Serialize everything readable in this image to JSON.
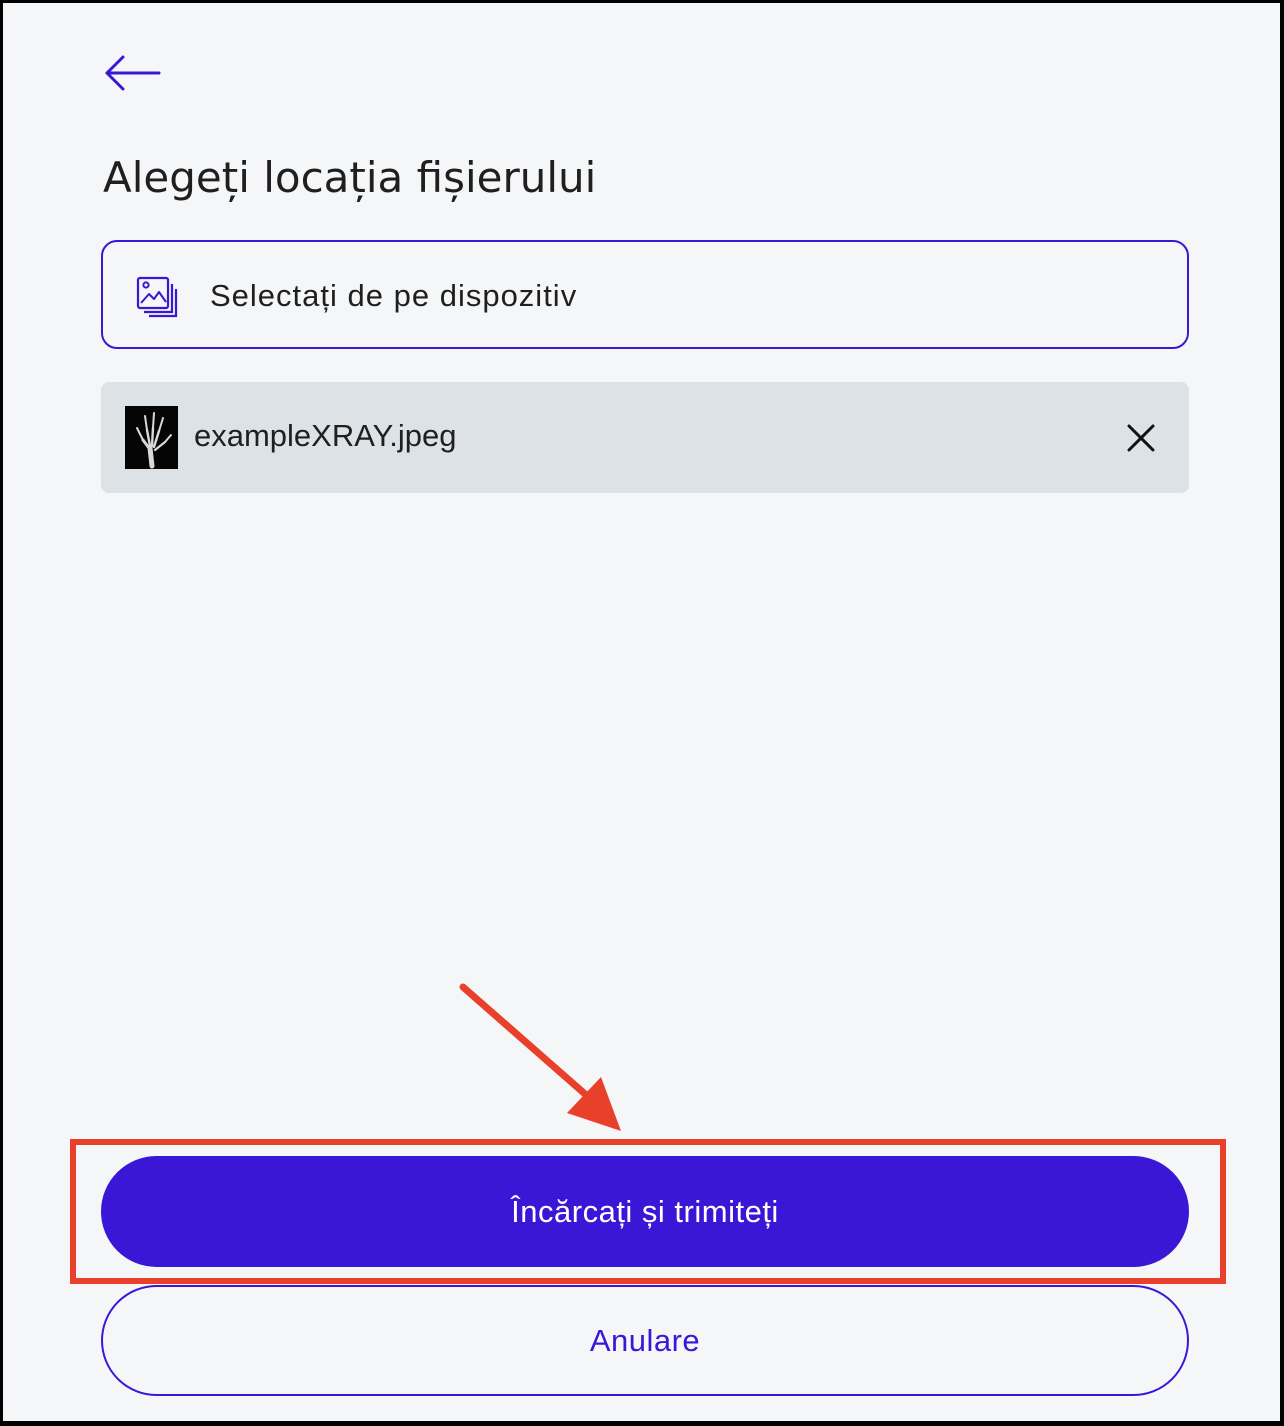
{
  "header": {
    "back_icon": "arrow-left-icon",
    "title": "Alegeți locația fișierului"
  },
  "select_device": {
    "icon": "image-gallery-icon",
    "label": "Selectați de pe dispozitiv"
  },
  "selected_file": {
    "thumbnail_icon": "xray-thumbnail",
    "name": "exampleXRAY.jpeg",
    "remove_icon": "close-icon"
  },
  "actions": {
    "primary_label": "Încărcați și trimiteți",
    "secondary_label": "Anulare"
  },
  "colors": {
    "accent": "#3a17d7",
    "background": "#f5f6f8",
    "file_row_bg": "#dde2e6",
    "annotation": "#e8402b"
  }
}
